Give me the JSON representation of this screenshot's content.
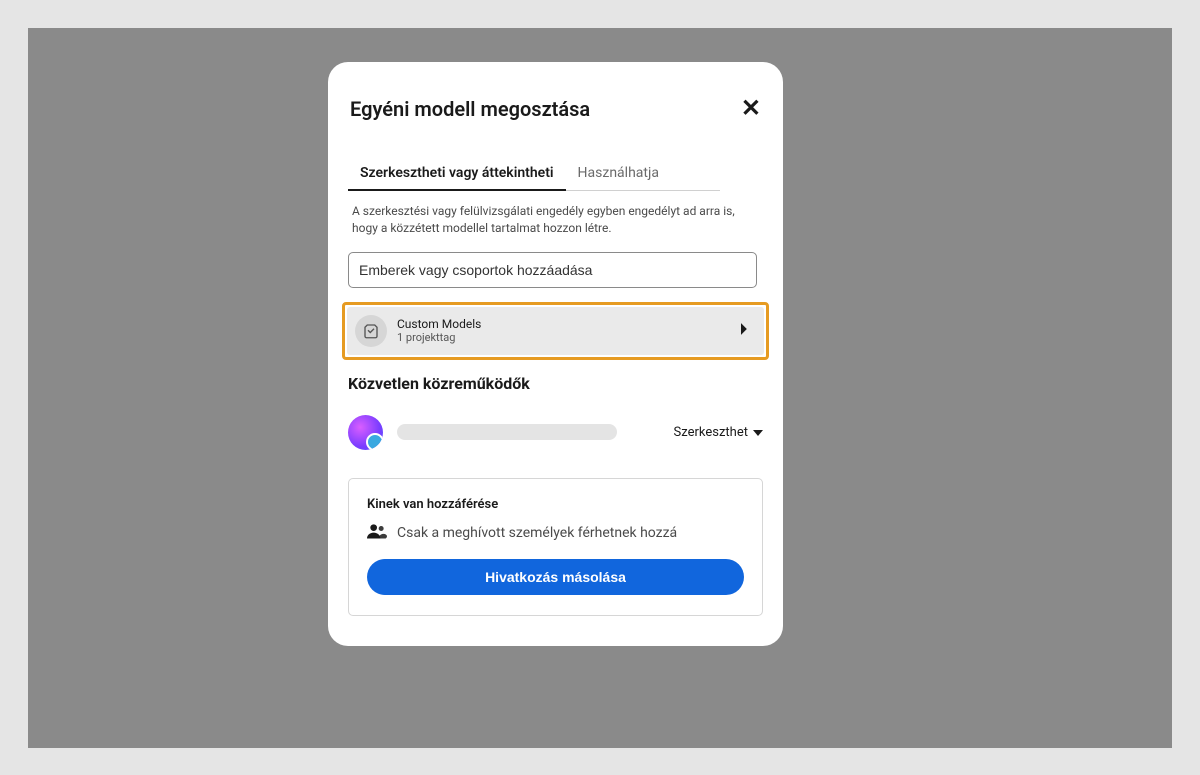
{
  "modal": {
    "title": "Egyéni modell megosztása",
    "tabs": {
      "edit_review": "Szerkesztheti vagy áttekintheti",
      "can_use": "Használhatja"
    },
    "description": "A szerkesztési vagy felülvizsgálati engedély egyben engedélyt ad arra is, hogy a közzétett modellel tartalmat hozzon létre.",
    "search_placeholder": "Emberek vagy csoportok hozzáadása",
    "project": {
      "name": "Custom Models",
      "meta": "1 projekttag"
    },
    "contributors_title": "Közvetlen közreműködők",
    "contributor": {
      "role": "Szerkeszthet"
    },
    "access": {
      "title": "Kinek van hozzáférése",
      "text": "Csak a meghívott személyek férhetnek hozzá",
      "copy_link": "Hivatkozás másolása"
    }
  }
}
